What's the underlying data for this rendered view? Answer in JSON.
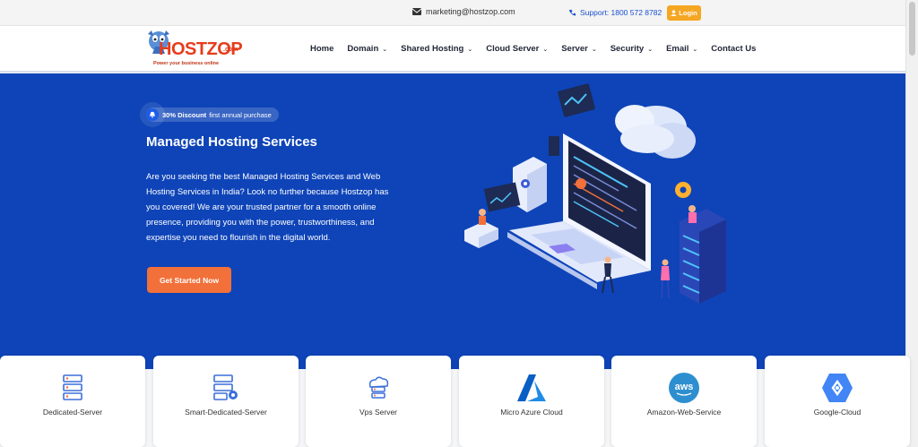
{
  "topbar": {
    "email": "marketing@hostzop.com",
    "support": "Support: 1800 572 8782",
    "login": "Login"
  },
  "brand": {
    "name": "HOSTZOP",
    "suffix": ".com",
    "tagline": "Power your business online"
  },
  "nav": {
    "items": [
      {
        "label": "Home",
        "dropdown": false
      },
      {
        "label": "Domain",
        "dropdown": true
      },
      {
        "label": "Shared Hosting",
        "dropdown": true
      },
      {
        "label": "Cloud Server",
        "dropdown": true
      },
      {
        "label": "Server",
        "dropdown": true
      },
      {
        "label": "Security",
        "dropdown": true
      },
      {
        "label": "Email",
        "dropdown": true
      },
      {
        "label": "Contact Us",
        "dropdown": false
      }
    ]
  },
  "hero": {
    "badge_strong": "30% Discount",
    "badge_text": "first annual purchase",
    "title": "Managed Hosting Services",
    "description": "Are you seeking the best Managed Hosting Services and Web Hosting Services in India? Look no further because Hostzop has you covered! We are your trusted partner for a smooth online presence, providing you with the power, trustworthiness, and expertise you need to flourish in the digital world.",
    "cta": "Get Started Now"
  },
  "services": [
    {
      "label": "Dedicated-Server",
      "icon": "dedicated-server-icon"
    },
    {
      "label": "Smart-Dedicated-Server",
      "icon": "smart-server-icon"
    },
    {
      "label": "Vps Server",
      "icon": "vps-cloud-icon"
    },
    {
      "label": "Micro Azure Cloud",
      "icon": "azure-icon"
    },
    {
      "label": "Amazon-Web-Service",
      "icon": "aws-icon"
    },
    {
      "label": "Google-Cloud",
      "icon": "google-cloud-icon"
    }
  ],
  "colors": {
    "hero": "#0e44b8",
    "cta": "#f2703a",
    "login": "#f5a623",
    "brand": "#e63c1c"
  }
}
